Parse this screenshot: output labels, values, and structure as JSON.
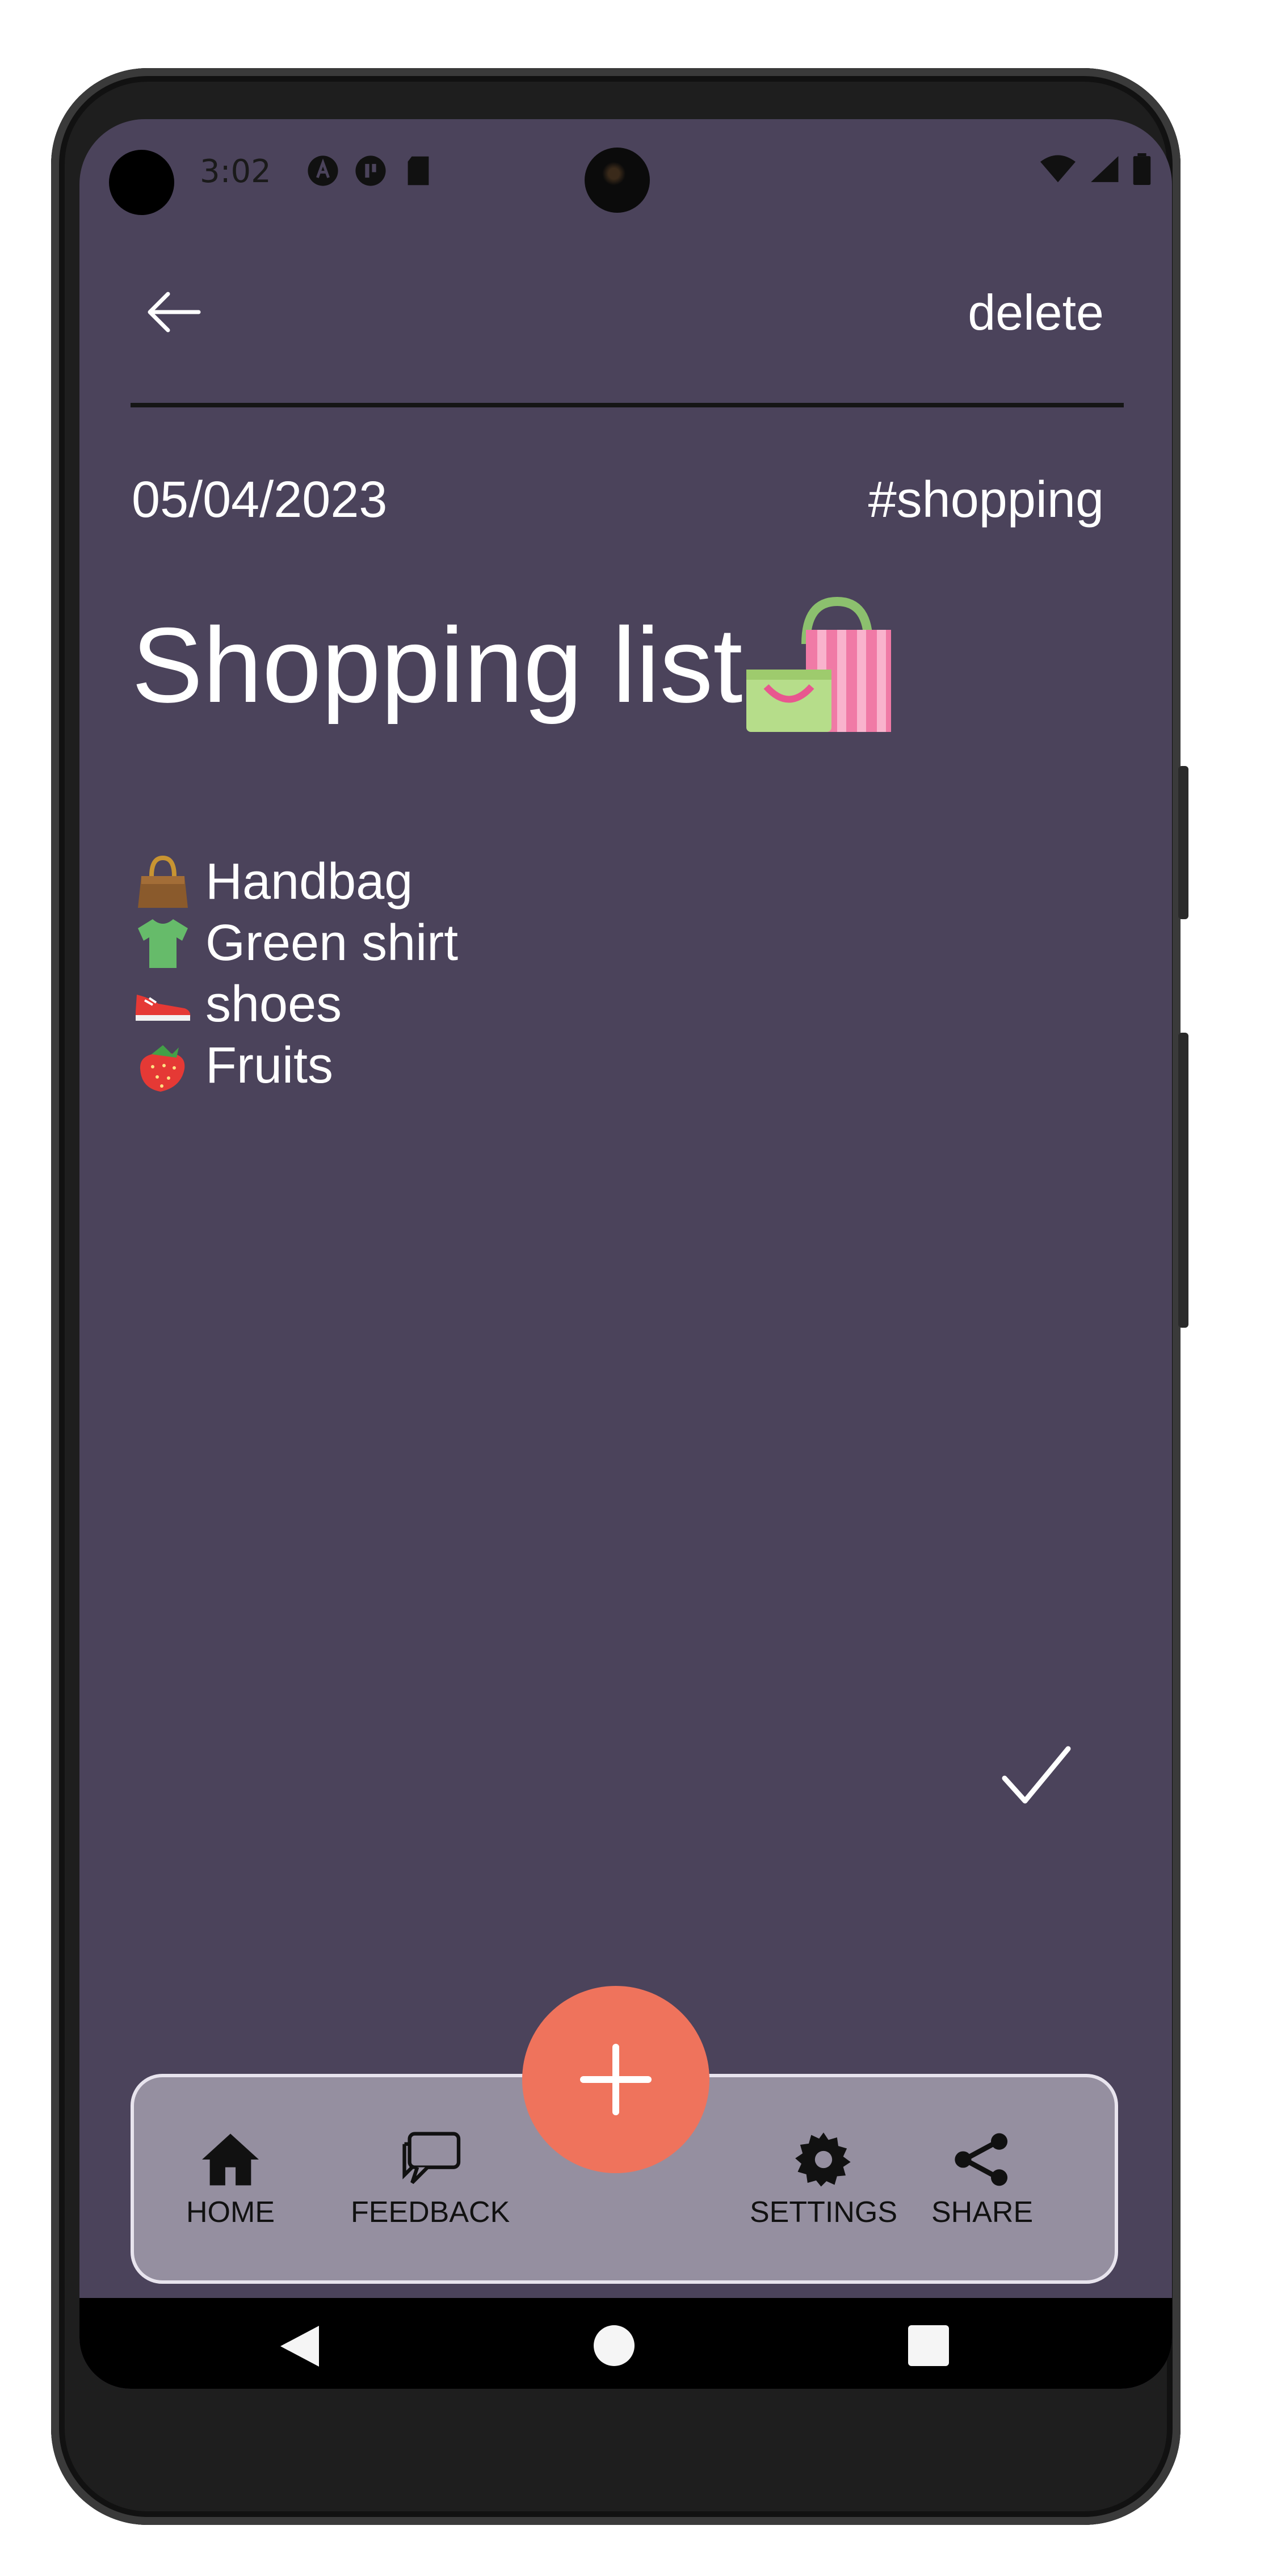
{
  "status_bar": {
    "time": "3:02"
  },
  "toolbar": {
    "delete_label": "delete"
  },
  "note": {
    "date": "05/04/2023",
    "tag": "#shopping",
    "title": "Shopping list",
    "items": [
      {
        "icon": "handbag-icon",
        "label": "Handbag"
      },
      {
        "icon": "tshirt-icon",
        "label": "Green shirt"
      },
      {
        "icon": "sneaker-icon",
        "label": "shoes"
      },
      {
        "icon": "strawberry-icon",
        "label": "Fruits"
      }
    ]
  },
  "bottom_nav": {
    "items": [
      {
        "icon": "home-icon",
        "label": "HOME"
      },
      {
        "icon": "feedback-icon",
        "label": "FEEDBACK"
      },
      {
        "icon": "settings-icon",
        "label": "SETTINGS"
      },
      {
        "icon": "share-icon",
        "label": "SHARE"
      }
    ]
  },
  "fab": {
    "icon": "plus-icon"
  },
  "colors": {
    "background": "#4b435b",
    "fab": "#ef735c",
    "bottom_nav": "#958fa0",
    "text": "#ffffff"
  }
}
